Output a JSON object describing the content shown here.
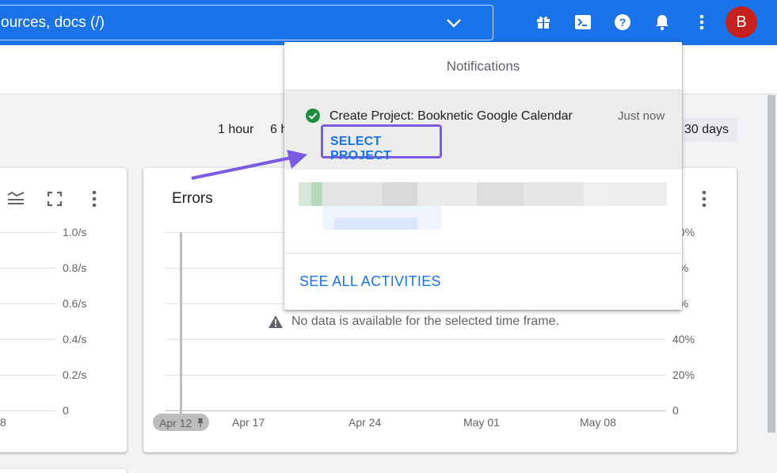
{
  "topbar": {
    "search_text": "ources, docs (/)",
    "avatar_letter": "B",
    "icons": [
      "gift-icon",
      "cloud-shell-icon",
      "help-icon",
      "bell-icon",
      "more-vert-icon"
    ]
  },
  "time_range": {
    "options": [
      "1 hour",
      "6 h",
      "30 days"
    ],
    "selected": "30 days"
  },
  "left_card": {
    "y_ticks": [
      "1.0/s",
      "0.8/s",
      "0.6/s",
      "0.4/s",
      "0.2/s",
      "0"
    ],
    "x_tick_partial": "8"
  },
  "errors_card": {
    "title": "Errors",
    "y_ticks": [
      "00%",
      "0%",
      "0%",
      "40%",
      "20%",
      "0"
    ],
    "x_ticks": [
      "Apr 17",
      "Apr 24",
      "May 01",
      "May 08"
    ],
    "pinned_tick": "Apr 12",
    "no_data_message": "No data is available for the selected time frame."
  },
  "notifications": {
    "title": "Notifications",
    "item": {
      "title": "Create Project: Booknetic Google Calendar",
      "time": "Just now",
      "action_label": "SELECT PROJECT"
    },
    "see_all_label": "SEE ALL ACTIVITIES"
  },
  "colors": {
    "brand": "#1a73e8",
    "avatar": "#c5221f",
    "success": "#1e8e3e",
    "highlight": "#7b5ce0"
  }
}
